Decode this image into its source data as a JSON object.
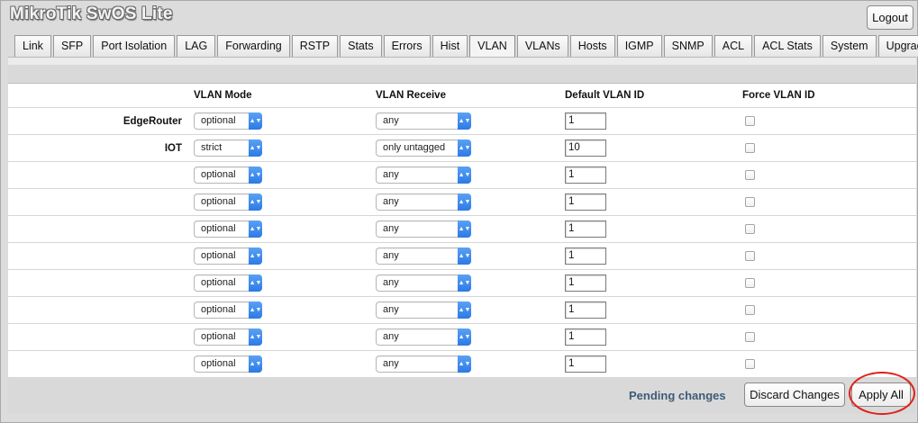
{
  "app": {
    "title": "MikroTik SwOS Lite",
    "logout_label": "Logout"
  },
  "tabs": [
    "Link",
    "SFP",
    "Port Isolation",
    "LAG",
    "Forwarding",
    "RSTP",
    "Stats",
    "Errors",
    "Hist",
    "VLAN",
    "VLANs",
    "Hosts",
    "IGMP",
    "SNMP",
    "ACL",
    "ACL Stats",
    "System",
    "Upgrade"
  ],
  "active_tab": "VLAN",
  "table": {
    "headers": {
      "mode": "VLAN Mode",
      "receive": "VLAN Receive",
      "default_vlan": "Default VLAN ID",
      "force": "Force VLAN ID"
    },
    "rows": [
      {
        "name": "EdgeRouter",
        "mode": "optional",
        "receive": "any",
        "default_vlan": "1",
        "force": false
      },
      {
        "name": "IOT",
        "mode": "strict",
        "receive": "only untagged",
        "default_vlan": "10",
        "force": false
      },
      {
        "name": "",
        "mode": "optional",
        "receive": "any",
        "default_vlan": "1",
        "force": false
      },
      {
        "name": "",
        "mode": "optional",
        "receive": "any",
        "default_vlan": "1",
        "force": false
      },
      {
        "name": "",
        "mode": "optional",
        "receive": "any",
        "default_vlan": "1",
        "force": false
      },
      {
        "name": "",
        "mode": "optional",
        "receive": "any",
        "default_vlan": "1",
        "force": false
      },
      {
        "name": "",
        "mode": "optional",
        "receive": "any",
        "default_vlan": "1",
        "force": false
      },
      {
        "name": "",
        "mode": "optional",
        "receive": "any",
        "default_vlan": "1",
        "force": false
      },
      {
        "name": "",
        "mode": "optional",
        "receive": "any",
        "default_vlan": "1",
        "force": false
      },
      {
        "name": "",
        "mode": "optional",
        "receive": "any",
        "default_vlan": "1",
        "force": false
      }
    ]
  },
  "footer": {
    "pending_text": "Pending changes",
    "discard_label": "Discard Changes",
    "apply_label": "Apply All"
  },
  "colors": {
    "highlight": "#e0201a",
    "select_arrow": "#2c7ae6",
    "pending": "#3e5c78"
  }
}
